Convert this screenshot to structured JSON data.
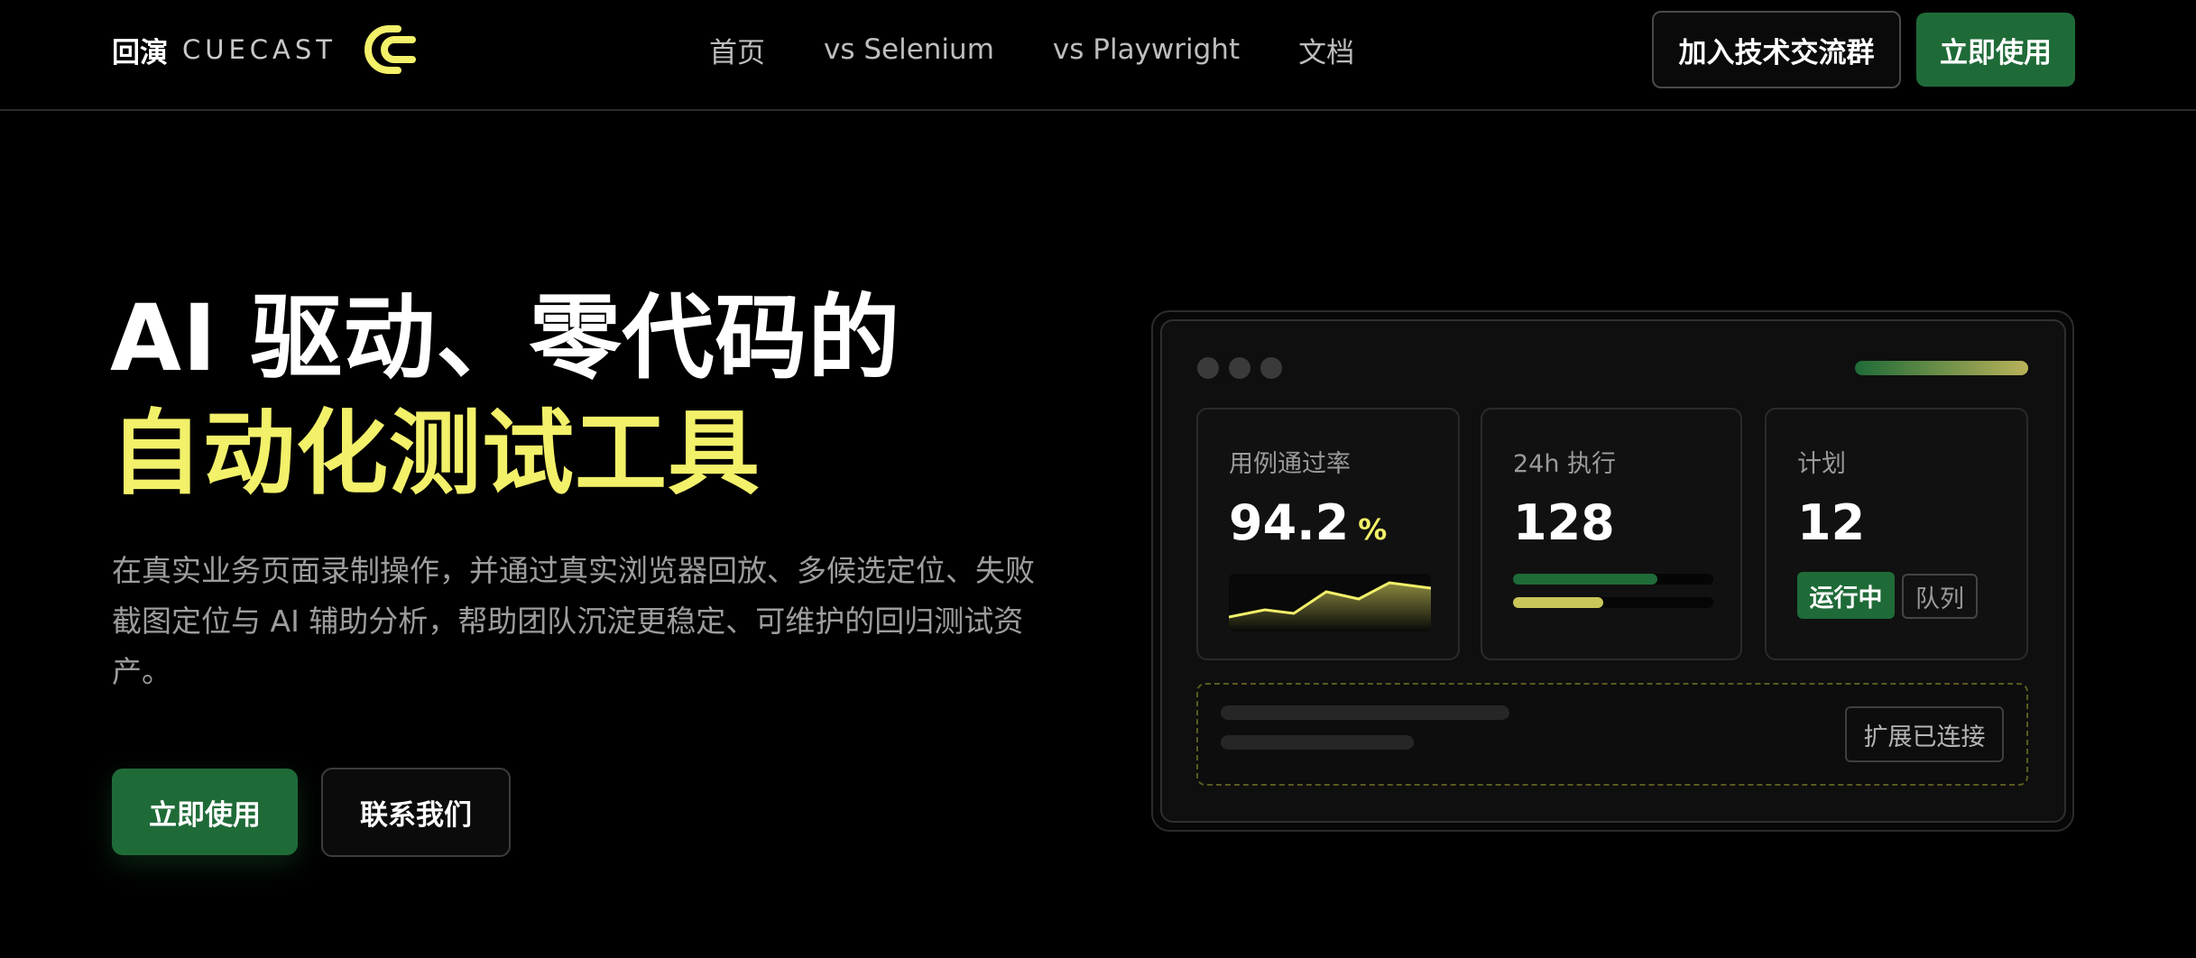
{
  "nav": {
    "brand_cn": "回演",
    "brand_en": "CUECAST",
    "logo_icon": "cuecast-c-logo",
    "links": [
      "首页",
      "vs Selenium",
      "vs Playwright",
      "文档"
    ],
    "join_group": "加入技术交流群",
    "cta": "立即使用"
  },
  "hero": {
    "title_line1": "AI 驱动、零代码的",
    "title_line2": "自动化测试工具",
    "description": "在真实业务页面录制操作，并通过真实浏览器回放、多候选定位、失败截图定位与 AI 辅助分析，帮助团队沉淀更稳定、可维护的回归测试资产。",
    "primary_button": "立即使用",
    "secondary_button": "联系我们"
  },
  "dashboard": {
    "cards": [
      {
        "label": "用例通过率",
        "value": "94.2",
        "unit": "%"
      },
      {
        "label": "24h 执行",
        "value": "128",
        "progress": [
          0.72,
          0.45
        ]
      },
      {
        "label": "计划",
        "value": "12",
        "tags": [
          "运行中",
          "队列"
        ]
      }
    ],
    "extension_status": "扩展已连接"
  },
  "colors": {
    "accent_yellow": "#f3f06a",
    "brand_green": "#1f6b38",
    "background": "#000000"
  }
}
